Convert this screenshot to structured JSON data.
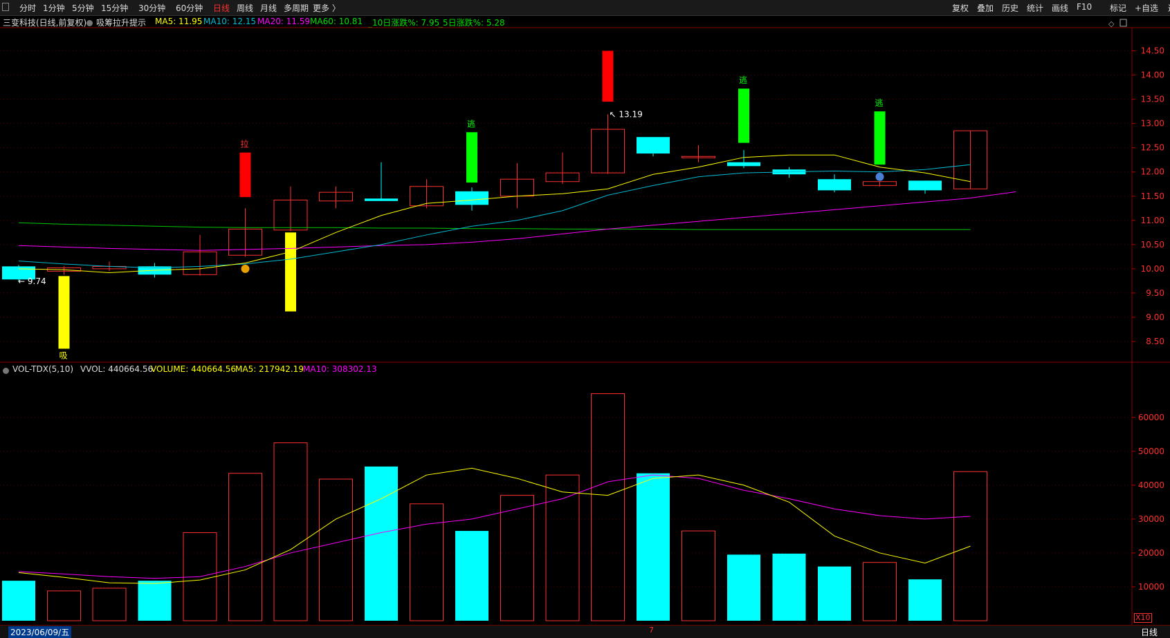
{
  "toolbar": {
    "left": [
      "分时",
      "1分钟",
      "5分钟",
      "15分钟",
      "30分钟",
      "60分钟",
      "日线",
      "周线",
      "月线",
      "多周期",
      "更多 〉"
    ],
    "active": "日线",
    "right": [
      "复权",
      "叠加",
      "历史",
      "统计",
      "画线",
      "F10",
      "标记",
      "+自选",
      "返回"
    ]
  },
  "info": {
    "title": "三变科技(日线,前复权)",
    "indicator": "吸筹拉升提示",
    "ma5": "MA5: 11.95",
    "ma10": "MA10: 12.15",
    "ma20": "MA20: 11.59",
    "ma60": "MA60: 10.81",
    "pct10": "_10日涨跌%: 7.95",
    "pct5": "_5日涨跌%: 5.28"
  },
  "vol_info": {
    "name": "VOL-TDX(5,10)",
    "vvol": "VVOL: 440664.56",
    "volume": "VOLUME: 440664.56",
    "ma5": "MA5: 217942.19",
    "ma10": "MA10: 308302.13"
  },
  "colors": {
    "up": "#ff3030",
    "down": "#00ffff",
    "ma5": "#ffff00",
    "ma10": "#00bcd4",
    "ma20": "#ff00ff",
    "ma60": "#00c800",
    "signal_buy": "#ffff00",
    "signal_escape": "#00ff00",
    "signal_pull": "#ff0000"
  },
  "chart_data": [
    {
      "type": "candlestick",
      "yticks": [
        8.5,
        9.0,
        9.5,
        10.0,
        10.5,
        11.0,
        11.5,
        12.0,
        12.5,
        13.0,
        13.5,
        14.0,
        14.5
      ],
      "ylim": [
        8.1,
        14.95
      ],
      "candles": [
        {
          "o": 10.05,
          "h": 10.08,
          "l": 9.74,
          "c": 9.78
        },
        {
          "o": 9.95,
          "h": 10.05,
          "l": 9.88,
          "c": 10.02
        },
        {
          "o": 10.0,
          "h": 10.15,
          "l": 9.95,
          "c": 10.05
        },
        {
          "o": 10.05,
          "h": 10.12,
          "l": 9.82,
          "c": 9.88
        },
        {
          "o": 9.88,
          "h": 10.7,
          "l": 9.86,
          "c": 10.35
        },
        {
          "o": 10.28,
          "h": 11.25,
          "l": 10.25,
          "c": 10.82
        },
        {
          "o": 10.8,
          "h": 11.7,
          "l": 10.78,
          "c": 11.42
        },
        {
          "o": 11.4,
          "h": 11.7,
          "l": 11.25,
          "c": 11.58
        },
        {
          "o": 11.45,
          "h": 12.2,
          "l": 11.4,
          "c": 11.4
        },
        {
          "o": 11.3,
          "h": 11.85,
          "l": 11.25,
          "c": 11.7
        },
        {
          "o": 11.6,
          "h": 11.68,
          "l": 11.2,
          "c": 11.32
        },
        {
          "o": 11.5,
          "h": 12.18,
          "l": 11.25,
          "c": 11.85
        },
        {
          "o": 11.8,
          "h": 12.4,
          "l": 11.75,
          "c": 11.98
        },
        {
          "o": 11.98,
          "h": 13.19,
          "l": 11.96,
          "c": 12.88
        },
        {
          "o": 12.72,
          "h": 12.72,
          "l": 12.32,
          "c": 12.38
        },
        {
          "o": 12.3,
          "h": 12.55,
          "l": 12.2,
          "c": 12.32
        },
        {
          "o": 12.2,
          "h": 12.45,
          "l": 12.08,
          "c": 12.12
        },
        {
          "o": 12.05,
          "h": 12.1,
          "l": 11.88,
          "c": 11.95
        },
        {
          "o": 11.85,
          "h": 11.95,
          "l": 11.58,
          "c": 11.62
        },
        {
          "o": 11.72,
          "h": 11.8,
          "l": 11.7,
          "c": 11.8
        },
        {
          "o": 11.82,
          "h": 11.82,
          "l": 11.55,
          "c": 11.62
        },
        {
          "o": 11.65,
          "h": 12.85,
          "l": 11.65,
          "c": 12.85
        }
      ],
      "ma5": [
        10.0,
        9.98,
        9.92,
        9.97,
        10.0,
        10.12,
        10.35,
        10.75,
        11.1,
        11.35,
        11.42,
        11.5,
        11.55,
        11.65,
        11.95,
        12.1,
        12.3,
        12.35,
        12.35,
        12.1,
        11.98,
        11.8,
        11.95
      ],
      "ma10": [
        10.16,
        10.1,
        10.05,
        10.02,
        10.05,
        10.1,
        10.2,
        10.35,
        10.5,
        10.7,
        10.88,
        11.0,
        11.2,
        11.52,
        11.72,
        11.9,
        11.98,
        12.0,
        12.02,
        12.0,
        12.05,
        12.15
      ],
      "ma20": [
        10.48,
        10.45,
        10.42,
        10.4,
        10.38,
        10.4,
        10.42,
        10.45,
        10.48,
        10.5,
        10.55,
        10.62,
        10.72,
        10.82,
        10.9,
        10.98,
        11.06,
        11.14,
        11.22,
        11.3,
        11.38,
        11.46,
        11.59
      ],
      "ma60": [
        10.95,
        10.92,
        10.9,
        10.88,
        10.86,
        10.85,
        10.85,
        10.85,
        10.84,
        10.84,
        10.83,
        10.83,
        10.82,
        10.82,
        10.82,
        10.81,
        10.81,
        10.81,
        10.81,
        10.81,
        10.81,
        10.81
      ],
      "signals": [
        {
          "idx": 1,
          "label": "吸",
          "top": 9.85,
          "bottom": 8.35,
          "kind": "buy"
        },
        {
          "idx": 5,
          "label": "拉",
          "top": 12.4,
          "bottom": 11.48,
          "kind": "pull"
        },
        {
          "idx": 6,
          "label": "",
          "top": 10.75,
          "bottom": 9.12,
          "kind": "buy"
        },
        {
          "idx": 10,
          "label": "逃",
          "top": 12.82,
          "bottom": 11.78,
          "kind": "escape"
        },
        {
          "idx": 13,
          "label": "",
          "top": 14.5,
          "bottom": 13.45,
          "kind": "pull"
        },
        {
          "idx": 16,
          "label": "逃",
          "top": 13.72,
          "bottom": 12.6,
          "kind": "escape"
        },
        {
          "idx": 19,
          "label": "逃",
          "top": 13.25,
          "bottom": 12.15,
          "kind": "escape"
        }
      ],
      "annotations": {
        "low_label": "9.74",
        "high_label": "13.19"
      }
    },
    {
      "type": "bar",
      "yticks": [
        10000,
        20000,
        30000,
        40000,
        50000,
        60000
      ],
      "ylim": [
        0,
        72000
      ],
      "values": [
        11800,
        8800,
        9600,
        11800,
        26000,
        43500,
        52500,
        41800,
        45500,
        34500,
        26500,
        37000,
        43000,
        67000,
        43500,
        26500,
        19500,
        19800,
        16000,
        17200,
        12200,
        44000
      ],
      "ma5": [
        14200,
        12800,
        11200,
        11000,
        12000,
        15000,
        21000,
        30000,
        36000,
        43000,
        45000,
        42000,
        38000,
        37000,
        42000,
        43000,
        40000,
        35000,
        25000,
        20000,
        17000,
        22000
      ],
      "ma10": [
        14500,
        13800,
        13000,
        12500,
        13000,
        16000,
        20000,
        23000,
        26000,
        28500,
        30000,
        33000,
        36000,
        41000,
        43000,
        42000,
        38500,
        36000,
        33000,
        31000,
        30000,
        30800
      ]
    }
  ],
  "footer": {
    "date": "2023/06/09/五",
    "mid": "7",
    "scale_label": "X10",
    "period": "日线"
  }
}
